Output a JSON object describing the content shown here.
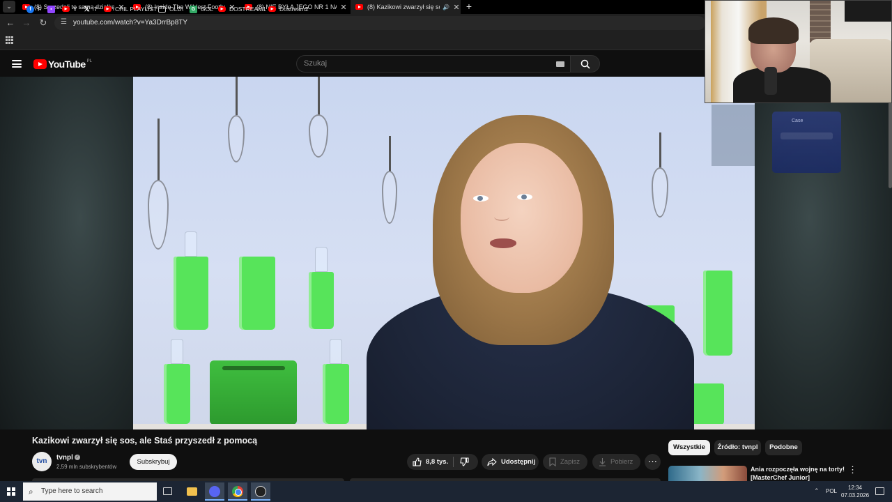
{
  "browser": {
    "tabs": [
      {
        "title": "(8) Sprzedali tę samą działkę dw",
        "active": false
      },
      {
        "title": "(8) Inside The Wildest Football",
        "active": false
      },
      {
        "title": "(8) NIE BYŁA JEGO NR 1 NA RA",
        "active": false
      },
      {
        "title": "(8) Kazikowi zwarzył się sos",
        "active": true
      }
    ],
    "url": "youtube.com/watch?v=Ya3DrrBp8TY",
    "bookmarks": [
      {
        "label": "F",
        "icon": "facebook-icon"
      },
      {
        "label": "",
        "icon": "twitch-icon"
      },
      {
        "label": "Y",
        "icon": "youtube-icon"
      },
      {
        "label": "T",
        "icon": "x-icon"
      },
      {
        "label": "CHIL PLAYLIST",
        "icon": "youtube-icon"
      },
      {
        "label": "OLD\\",
        "icon": "folder-icon"
      },
      {
        "label": "GOL",
        "icon": "gol-icon"
      },
      {
        "label": "DOSTREAM1",
        "icon": "youtube-icon"
      },
      {
        "label": "Dostream2",
        "icon": "youtube-icon"
      }
    ]
  },
  "youtube": {
    "logo_text": "YouTube",
    "country_code": "PL",
    "search_placeholder": "Szukaj"
  },
  "video": {
    "title": "Kazikowi zwarzył się sos, ale Staś przyszedł z pomocą",
    "channel": {
      "name": "tvnpl",
      "avatar_text": "tvn",
      "subscribers": "2,59 mln subskrybentów"
    },
    "subscribe_label": "Subskrybuj",
    "likes": "8,8 tys.",
    "share_label": "Udostępnij",
    "save_label": "Zapisz",
    "download_label": "Pobierz"
  },
  "chips": [
    "Wszystkie",
    "Źródło: tvnpl",
    "Podobne"
  ],
  "recommendation": {
    "title": "Ania rozpoczęła wojnę na torty! [MasterChef Junior]"
  },
  "overlay": {
    "card_title": "Case"
  },
  "taskbar": {
    "search_placeholder": "Type here to search",
    "language": "POL",
    "time": "12:34",
    "date": "07.03.2026"
  },
  "colors": {
    "youtube_red": "#ff0000",
    "accent_blue": "#3ea6ff"
  }
}
